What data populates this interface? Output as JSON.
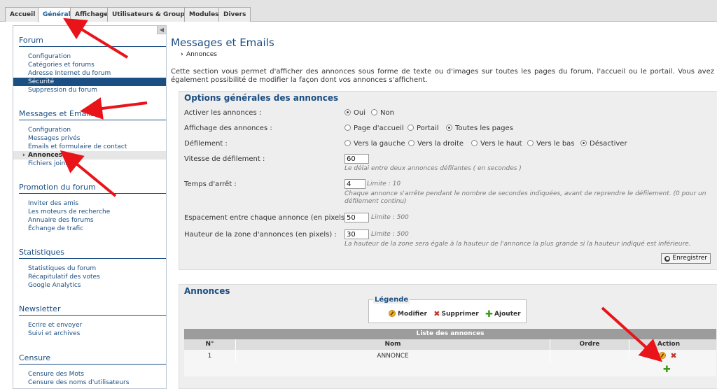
{
  "tabs": [
    "Accueil",
    "Général",
    "Affichage",
    "Utilisateurs & Groupes",
    "Modules",
    "Divers"
  ],
  "sidebar": {
    "collapse_icon": "◀",
    "sections": [
      {
        "title": "Forum",
        "items": [
          "Configuration",
          "Catégories et forums",
          "Adresse Internet du forum",
          "Sécurité",
          "Suppression du forum"
        ]
      },
      {
        "title": "Messages et Emails",
        "items": [
          "Configuration",
          "Messages privés",
          "Emails et formulaire de contact",
          "Annonces",
          "Fichiers joints"
        ]
      },
      {
        "title": "Promotion du forum",
        "items": [
          "Inviter des amis",
          "Les moteurs de recherche",
          "Annuaire des forums",
          "Échange de trafic"
        ]
      },
      {
        "title": "Statistiques",
        "items": [
          "Statistiques du forum",
          "Récapitulatif des votes",
          "Google Analytics"
        ]
      },
      {
        "title": "Newsletter",
        "items": [
          "Ecrire et envoyer",
          "Suivi et archives"
        ]
      },
      {
        "title": "Censure",
        "items": [
          "Censure des Mots",
          "Censure des noms d'utilisateurs"
        ]
      }
    ]
  },
  "main": {
    "title": "Messages et Emails",
    "breadcrumb": "Annonces",
    "breadcrumb_arrow": "›",
    "intro": "Cette section vous permet d'afficher des annonces sous forme de texte ou d'images sur toutes les pages du forum, l'accueil ou le portail. Vous avez également possibilité de modifier la façon dont vos annonces s'affichent."
  },
  "options": {
    "title": "Options générales des annonces",
    "activer": {
      "label": "Activer les annonces :",
      "choices": [
        "Oui",
        "Non"
      ],
      "selected": 0
    },
    "affichage": {
      "label": "Affichage des annonces :",
      "choices": [
        "Page d'accueil",
        "Portail",
        "Toutes les pages"
      ],
      "selected": 2
    },
    "defilement": {
      "label": "Défilement :",
      "choices": [
        "Vers la gauche",
        "Vers la droite",
        "Vers le haut",
        "Vers le bas",
        "Désactiver"
      ],
      "selected": 4
    },
    "vitesse": {
      "label": "Vitesse de défilement :",
      "value": "60",
      "hint": "Le délai entre deux annonces défilantes ( en secondes )"
    },
    "arret": {
      "label": "Temps d'arrêt :",
      "value": "4",
      "limit": "Limite : 10",
      "hint": "Chaque annonce s'arrête pendant le nombre de secondes indiquées, avant de reprendre le défilement. (0 pour un défilement continu)"
    },
    "espacement": {
      "label": "Espacement entre chaque annonce (en pixels) :",
      "value": "50",
      "limit": "Limite : 500"
    },
    "hauteur": {
      "label": "Hauteur de la zone d'annonces (en pixels) :",
      "value": "30",
      "limit": "Limite : 500",
      "hint": "La hauteur de la zone sera égale à la hauteur de l'annonce la plus grande si la hauteur indiqué est inférieure."
    },
    "save_button": "Enregistrer"
  },
  "annonces": {
    "title": "Annonces",
    "legend": {
      "title": "Légende",
      "edit": "Modifier",
      "delete": "Supprimer",
      "add": "Ajouter"
    },
    "table": {
      "caption": "Liste des annonces",
      "headers": [
        "N°",
        "Nom",
        "Ordre",
        "Action"
      ],
      "rows": [
        {
          "num": "1",
          "name": "ANNONCE",
          "order": ""
        }
      ]
    }
  },
  "colors": {
    "accent": "#1b4e82",
    "annotation_arrow": "#e8141a"
  },
  "icons": {
    "edit": "edit-icon",
    "delete": "delete-icon",
    "add": "add-icon"
  }
}
